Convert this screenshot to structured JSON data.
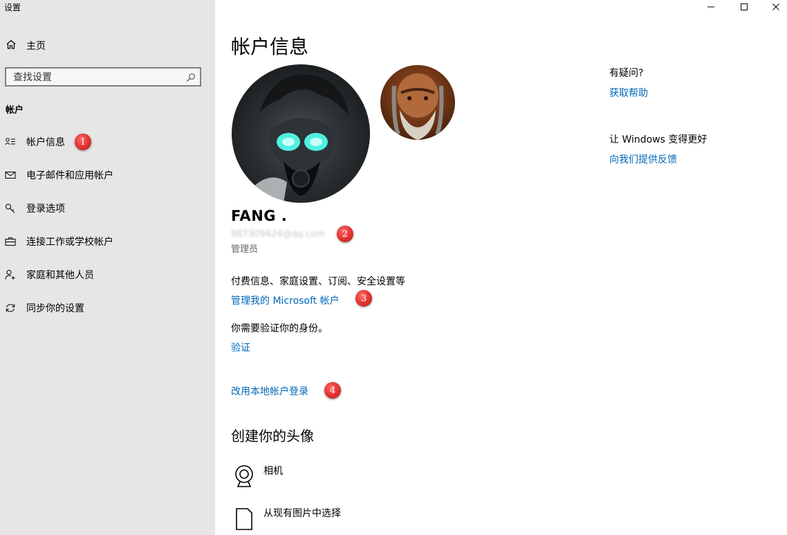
{
  "window": {
    "title": "设置",
    "minimize_glyph": "─",
    "maximize_glyph": "☐",
    "close_glyph": "✕"
  },
  "sidebar": {
    "home_label": "主页",
    "home_icon": "home-icon",
    "search_placeholder": "查找设置",
    "search_icon": "search-icon",
    "section_heading": "帐户",
    "items": [
      {
        "label": "帐户信息",
        "icon": "person-card-icon",
        "selected": true
      },
      {
        "label": "电子邮件和应用帐户",
        "icon": "mail-icon"
      },
      {
        "label": "登录选项",
        "icon": "key-icon"
      },
      {
        "label": "连接工作或学校帐户",
        "icon": "briefcase-icon"
      },
      {
        "label": "家庭和其他人员",
        "icon": "person-add-icon"
      },
      {
        "label": "同步你的设置",
        "icon": "sync-icon"
      }
    ]
  },
  "main": {
    "title": "帐户信息",
    "user": {
      "name": "FANG .",
      "email": "987309424@qq.com",
      "role": "管理员"
    },
    "billing_text": "付费信息、家庭设置、订阅、安全设置等",
    "manage_link": "管理我的 Microsoft 帐户",
    "verify_text": "你需要验证你的身份。",
    "verify_link": "验证",
    "local_account_link": "改用本地帐户登录",
    "create_avatar_heading": "创建你的头像",
    "avatar_options": [
      {
        "label": "相机",
        "icon": "camera-icon"
      },
      {
        "label": "从现有图片中选择",
        "icon": "file-icon"
      }
    ]
  },
  "right_panel": {
    "question": "有疑问?",
    "help_link": "获取帮助",
    "improve_text": "让 Windows 变得更好",
    "feedback_link": "向我们提供反馈"
  },
  "annotations": [
    "1",
    "2",
    "3",
    "4"
  ],
  "colors": {
    "sidebar_bg": "#e6e6e6",
    "link": "#0067b8",
    "badge": "#e53935"
  }
}
